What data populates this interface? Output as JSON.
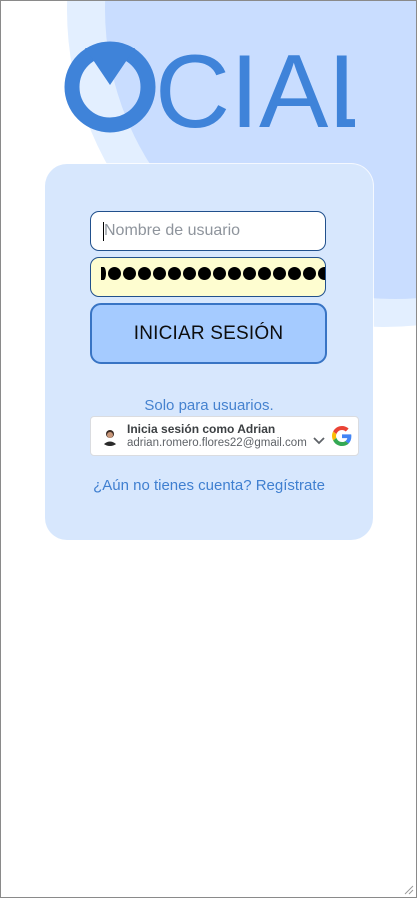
{
  "logo": {
    "text": "CIAL"
  },
  "login_form": {
    "username_placeholder": "Nombre de usuario",
    "password_masked_count": 15,
    "submit_label": "INICIAR SESIÓN"
  },
  "google_signin": {
    "caption": "Solo para usuarios.",
    "title": "Inicia sesión como Adrian",
    "email": "adrian.romero.flores22@gmail.com"
  },
  "register_link": "¿Aún no tienes cuenta? Regístrate",
  "colors": {
    "brand_blue": "#3f83d9",
    "card_bg": "#d7e7fd",
    "button_bg": "#a5cbff",
    "password_bg": "#fefdd0"
  }
}
